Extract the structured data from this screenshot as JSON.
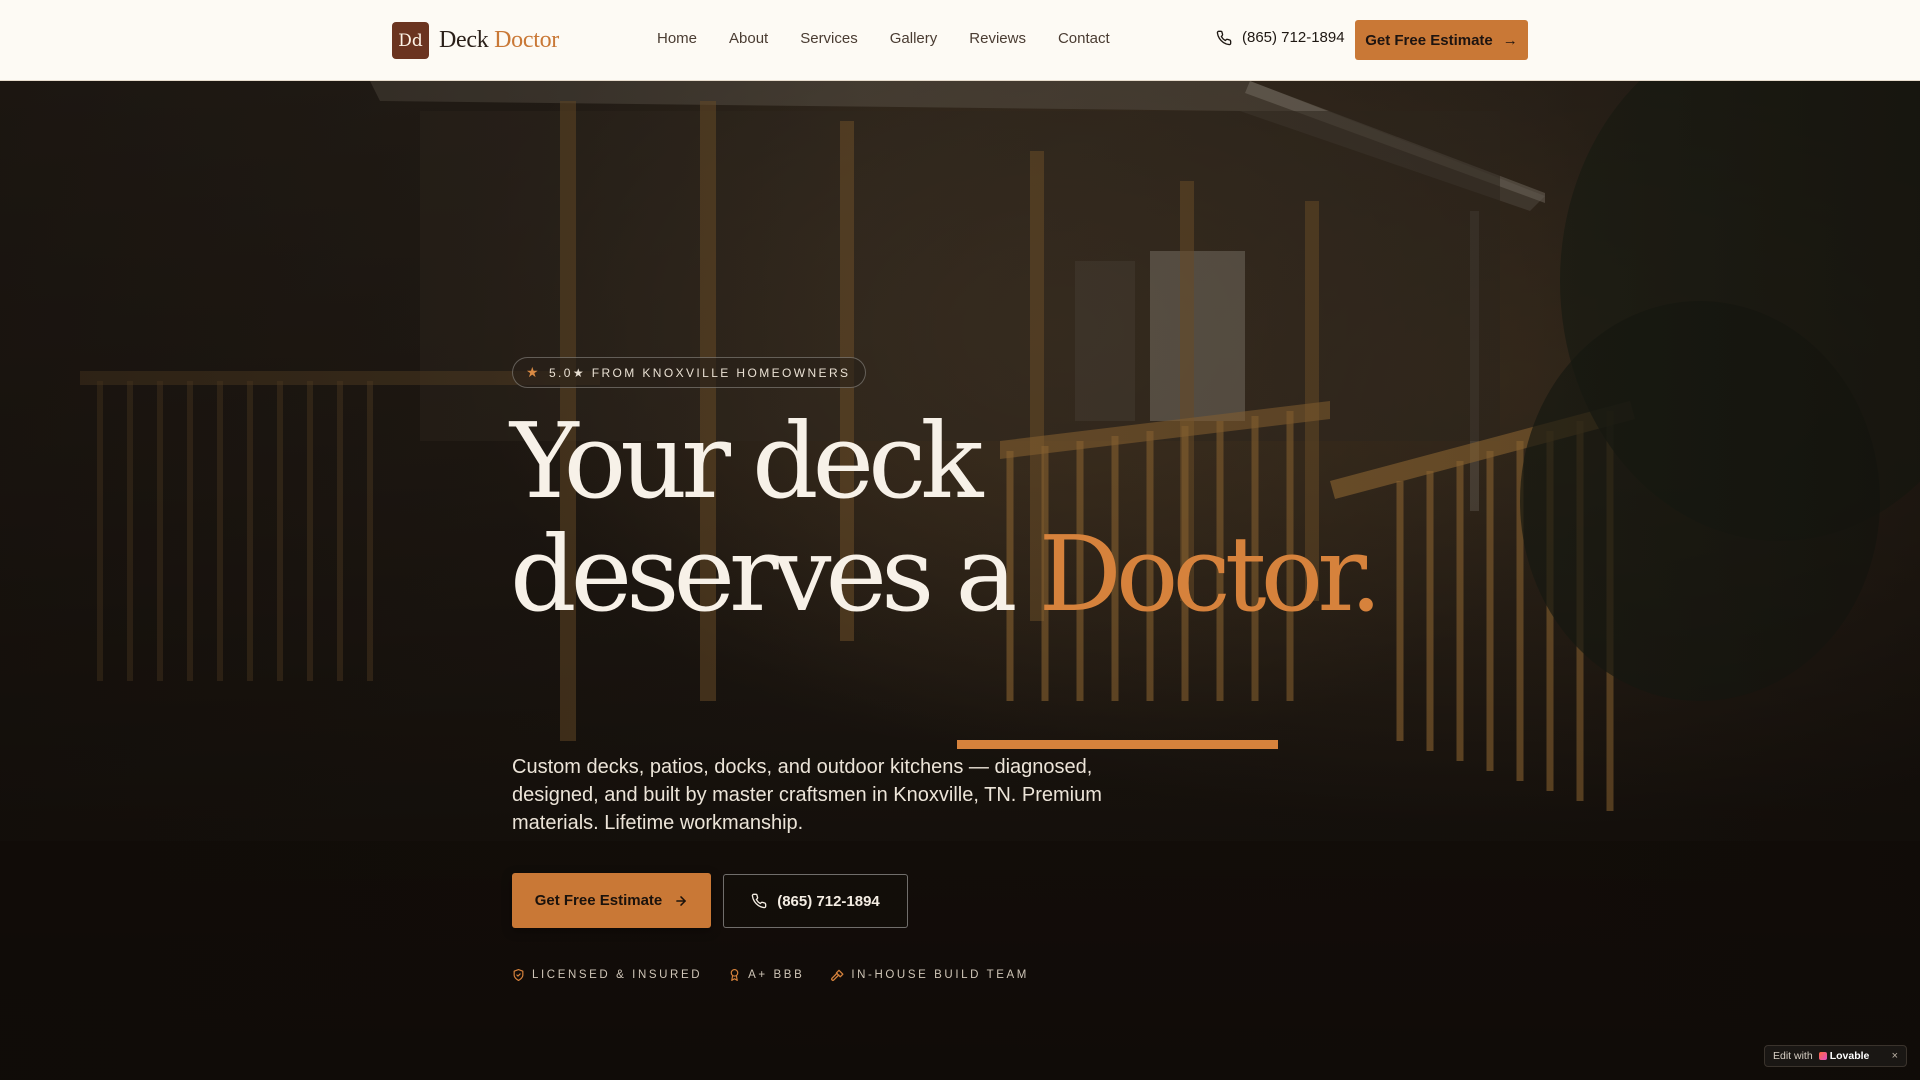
{
  "brand": {
    "mark": "Dd",
    "name_primary": "Deck",
    "name_accent": "Doctor"
  },
  "nav": {
    "items": [
      "Home",
      "About",
      "Services",
      "Gallery",
      "Reviews",
      "Contact"
    ]
  },
  "header": {
    "phone": "(865) 712-1894",
    "cta_label": "Get Free Estimate",
    "cta_arrow": "→"
  },
  "hero": {
    "badge": "5.0★ FROM KNOXVILLE HOMEOWNERS",
    "headline_line1": "Your deck",
    "headline_line2": "deserves a ",
    "headline_accent": "Doctor.",
    "subtitle": "Custom decks, patios, docks, and outdoor kitchens — diagnosed, designed, and built by master craftsmen in Knoxville, TN. Premium materials. Lifetime workmanship.",
    "cta_primary": "Get Free Estimate",
    "cta_secondary": "(865) 712-1894",
    "trust": [
      "LICENSED & INSURED",
      "A+ BBB",
      "IN-HOUSE BUILD TEAM"
    ]
  },
  "lovable": {
    "label": "Edit with",
    "brand": "Lovable",
    "close": "×"
  },
  "colors": {
    "accent": "#c97836",
    "dark": "#1a140f",
    "cream": "#fdfaf4",
    "brand_mark": "#6b3420"
  }
}
